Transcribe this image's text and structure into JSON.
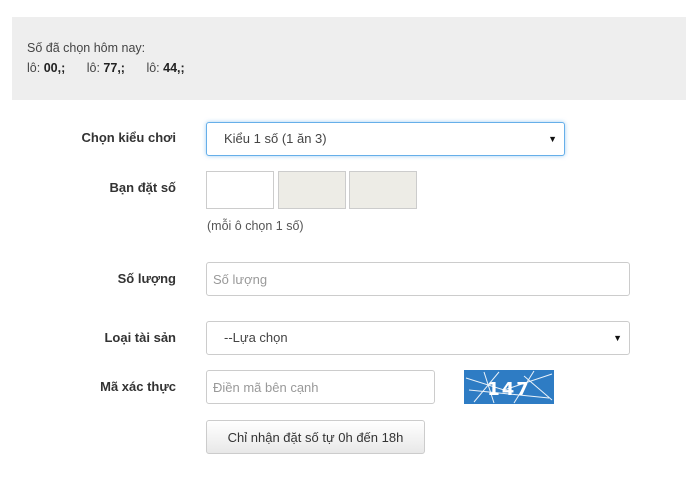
{
  "summary": {
    "title": "Số đã chọn hôm nay:",
    "picks": [
      {
        "prefix": "lô:",
        "number": "00",
        "suffix": ",;"
      },
      {
        "prefix": "lô:",
        "number": "77",
        "suffix": ",;"
      },
      {
        "prefix": "lô:",
        "number": "44",
        "suffix": ",;"
      }
    ]
  },
  "form": {
    "play_type": {
      "label": "Chọn kiểu chơi",
      "selected": "Kiểu 1 số (1 ăn 3)"
    },
    "bet_number": {
      "label": "Bạn đặt số",
      "hint": "(mỗi ô chọn 1 số)"
    },
    "quantity": {
      "label": "Số lượng",
      "placeholder": "Số lượng"
    },
    "asset_type": {
      "label": "Loại tài sản",
      "selected": "--Lựa chọn"
    },
    "captcha": {
      "label": "Mã xác thực",
      "placeholder": "Điền mã bên cạnh",
      "code": "147"
    },
    "submit_label": "Chỉ nhận đặt số tự 0h đến 18h"
  },
  "icons": {
    "dropdown_caret": "caret-down-icon"
  },
  "colors": {
    "focus_border": "#66afe9",
    "captcha_bg": "#2e7cc4",
    "summary_bg": "#eeeeee",
    "disabled_box": "#edece6"
  }
}
